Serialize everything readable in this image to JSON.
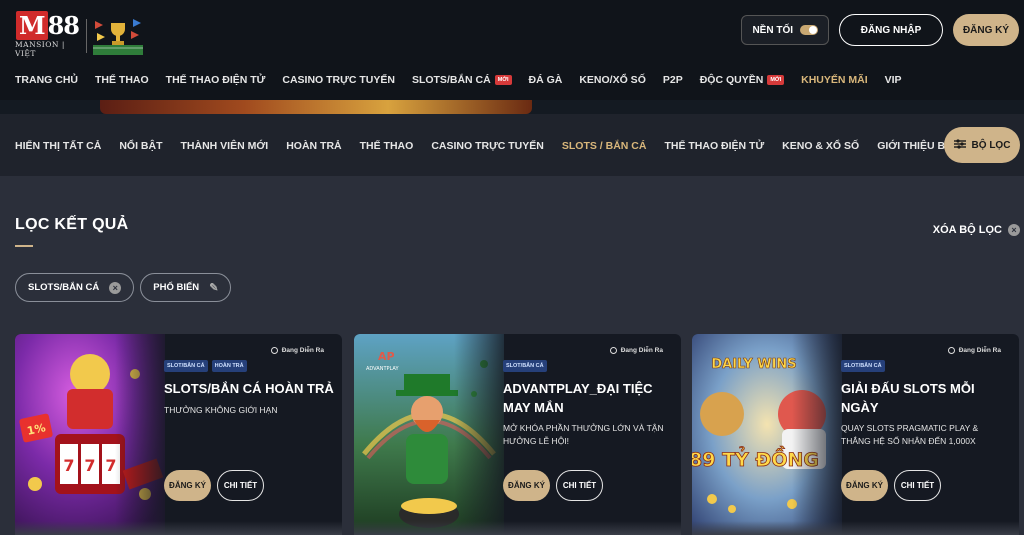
{
  "brand": {
    "logo_text": "M88",
    "logo_sub": "MANSION | VIỆT"
  },
  "header": {
    "dark_mode_label": "NỀN TỐI",
    "login_label": "ĐĂNG NHẬP",
    "register_label": "ĐĂNG KÝ"
  },
  "main_nav": [
    {
      "label": "TRANG CHỦ",
      "badge": ""
    },
    {
      "label": "THỂ THAO",
      "badge": ""
    },
    {
      "label": "THỂ THAO ĐIỆN TỬ",
      "badge": ""
    },
    {
      "label": "CASINO TRỰC TUYẾN",
      "badge": ""
    },
    {
      "label": "SLOTS/BẮN CÁ",
      "badge": "MỚI"
    },
    {
      "label": "ĐÁ GÀ",
      "badge": ""
    },
    {
      "label": "KENO/XỔ SỐ",
      "badge": ""
    },
    {
      "label": "P2P",
      "badge": ""
    },
    {
      "label": "ĐỘC QUYỀN",
      "badge": "MỚI"
    },
    {
      "label": "KHUYẾN MÃI",
      "badge": ""
    },
    {
      "label": "VIP",
      "badge": ""
    }
  ],
  "filter_tabs": {
    "items": [
      "HIỂN THỊ TẤT CẢ",
      "NỔI BẬT",
      "THÀNH VIÊN MỚI",
      "HOÀN TRẢ",
      "THỂ THAO",
      "CASINO TRỰC TUYẾN",
      "SLOTS / BẮN CÁ",
      "THỂ THAO ĐIỆN TỬ",
      "KENO & XỔ SỐ",
      "GIỚI THIỆU BẠN CHƠI"
    ],
    "active_index": 6,
    "filter_button": "BỘ LỌC"
  },
  "results": {
    "title": "LỌC KẾT QUẢ",
    "clear_label": "XÓA BỘ LỌC",
    "chips": [
      "SLOTS/BẮN CÁ",
      "PHỔ BIẾN"
    ]
  },
  "cards": [
    {
      "status": "Đang Diễn Ra",
      "tags": [
        "SLOT/BẮN CÁ",
        "HOÀN TRẢ"
      ],
      "title": "SLOTS/BẮN CÁ HOÀN TRẢ",
      "desc": "THƯỞNG KHÔNG GIỚI HẠN",
      "register": "ĐĂNG KÝ",
      "details": "CHI TIẾT",
      "art_text": "1%"
    },
    {
      "status": "Đang Diễn Ra",
      "tags": [
        "SLOT/BẮN CÁ"
      ],
      "title": "ADVANTPLAY_ĐẠI TIỆC MAY MẮN",
      "desc": "MỞ KHÓA PHẦN THƯỞNG LỚN VÀ TẬN HƯỞNG LỄ HỘI!",
      "register": "ĐĂNG KÝ",
      "details": "CHI TIẾT",
      "art_text": "ADVANTPLAY"
    },
    {
      "status": "Đang Diễn Ra",
      "tags": [
        "SLOT/BẮN CÁ"
      ],
      "title": "GIẢI ĐẤU SLOTS MỖI NGÀY",
      "desc": "QUAY SLOTS PRAGMATIC PLAY & THẮNG HỆ SỐ NHÂN ĐẾN 1,000X",
      "register": "ĐĂNG KÝ",
      "details": "CHI TIẾT",
      "art_text": "89 TỶ ĐỒNG",
      "art_text2": "DAILY WINS"
    }
  ]
}
